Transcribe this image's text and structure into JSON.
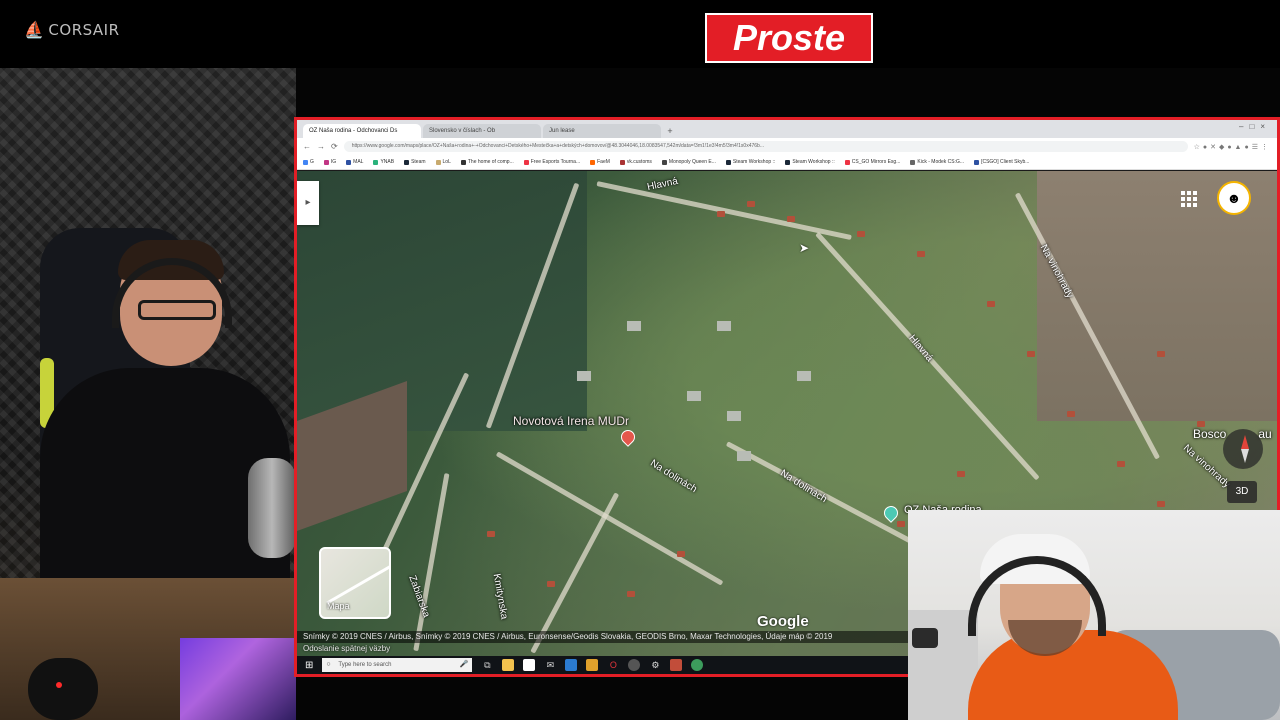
{
  "overlay": {
    "sponsor_logo": "CORSAIR",
    "sponsor_icon": "corsair-sails-icon",
    "show_logo": "Proste",
    "brand_color": "#e31e26"
  },
  "browser": {
    "tabs": [
      {
        "label": "OZ Naša rodina - Odchovanci Ds",
        "active": true
      },
      {
        "label": "Slovensko v číslach - Ob",
        "active": false
      },
      {
        "label": "Jun lease",
        "active": false
      }
    ],
    "url": "https://www.google.com/maps/place/OZ+Naša+rodina+-+Odchovanci+Detského+Mestečka+a+detských+domovov/@48.3044046,18.0083547,542m/data=!3m1!1e3!4m5!3m4!1s0x476b...",
    "bookmarks": [
      "G",
      "IG",
      "MAL",
      "YNAB",
      "Steam",
      "LoL",
      "The home of comp...",
      "Free Esports Tourna...",
      "FaeM",
      "vk.customs",
      "Monopoly Queen E...",
      "Steam Workshop ::",
      "Steam Workshop ::",
      "CS_GO Mirrors Esg...",
      "Kick - Modek CS:G...",
      "[CSGO] Client Skyb..."
    ]
  },
  "map": {
    "labels": {
      "hlavna_top": "Hlavná",
      "hlavna_mid": "Hlavná",
      "na_vinohrady": "Na vinohrady",
      "na_vinohrady_2": "Na vinohrady",
      "na_dolinach_1": "Na dolinách",
      "na_dolinach_2": "Na dolinách",
      "kmitynska": "Kmitynska",
      "zabiarska": "Zabiarska",
      "bosco": "Bosco",
      "bosco_suffix": "au"
    },
    "places": {
      "irena": "Novotová Irena MUDr",
      "oz": "OZ Naša rodina"
    },
    "layer_button": "Mapa",
    "btn_3d": "3D",
    "google": "Google",
    "attribution": "Snímky © 2019 CNES / Airbus, Snímky © 2019 CNES / Airbus, Euronsense/Geodis Slovakia, GEODIS Brno, Maxar Technologies, Údaje máp © 2019",
    "feedback": "Odoslanie spätnej väzby"
  },
  "taskbar": {
    "search_placeholder": "Type here to search"
  }
}
